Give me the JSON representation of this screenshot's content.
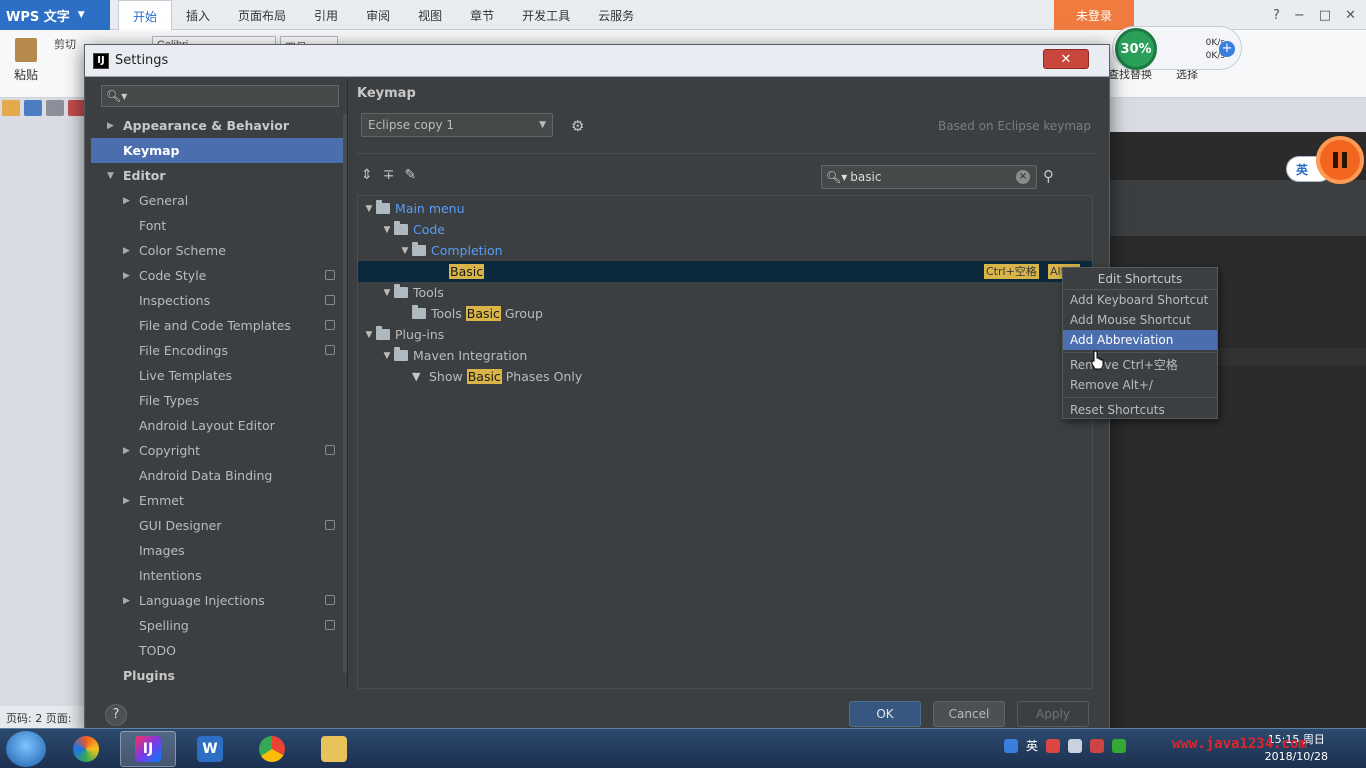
{
  "wps": {
    "app_name": "WPS 文字",
    "tabs": [
      "开始",
      "插入",
      "页面布局",
      "引用",
      "审阅",
      "视图",
      "章节",
      "开发工具",
      "云服务"
    ],
    "login": "未登录",
    "window_controls": [
      "?",
      "−",
      "□",
      "✕"
    ],
    "paste_label": "粘贴",
    "font_name": "Calibri",
    "font_size": "四号",
    "find_label": "查找替换",
    "select_label": "选择",
    "status_text": "页码: 2  页面:",
    "cut_label": "剪切"
  },
  "netmon": {
    "percent": "30%",
    "up": "0K/s",
    "down": "0K/s"
  },
  "recorder": {
    "lang": "英"
  },
  "dialog": {
    "title": "Settings",
    "close": "✕",
    "search_placeholder": "",
    "left_tree": [
      {
        "label": "Appearance & Behavior",
        "level": 0,
        "arrow": "▶",
        "bold": true
      },
      {
        "label": "Keymap",
        "level": 0,
        "arrow": "",
        "bold": true,
        "selected": true
      },
      {
        "label": "Editor",
        "level": 0,
        "arrow": "▼",
        "bold": true
      },
      {
        "label": "General",
        "level": 1,
        "arrow": "▶"
      },
      {
        "label": "Font",
        "level": 1,
        "arrow": ""
      },
      {
        "label": "Color Scheme",
        "level": 1,
        "arrow": "▶"
      },
      {
        "label": "Code Style",
        "level": 1,
        "arrow": "▶",
        "cfg": true
      },
      {
        "label": "Inspections",
        "level": 1,
        "arrow": "",
        "cfg": true
      },
      {
        "label": "File and Code Templates",
        "level": 1,
        "arrow": "",
        "cfg": true
      },
      {
        "label": "File Encodings",
        "level": 1,
        "arrow": "",
        "cfg": true
      },
      {
        "label": "Live Templates",
        "level": 1,
        "arrow": ""
      },
      {
        "label": "File Types",
        "level": 1,
        "arrow": ""
      },
      {
        "label": "Android Layout Editor",
        "level": 1,
        "arrow": ""
      },
      {
        "label": "Copyright",
        "level": 1,
        "arrow": "▶",
        "cfg": true
      },
      {
        "label": "Android Data Binding",
        "level": 1,
        "arrow": ""
      },
      {
        "label": "Emmet",
        "level": 1,
        "arrow": "▶"
      },
      {
        "label": "GUI Designer",
        "level": 1,
        "arrow": "",
        "cfg": true
      },
      {
        "label": "Images",
        "level": 1,
        "arrow": ""
      },
      {
        "label": "Intentions",
        "level": 1,
        "arrow": ""
      },
      {
        "label": "Language Injections",
        "level": 1,
        "arrow": "▶",
        "cfg": true
      },
      {
        "label": "Spelling",
        "level": 1,
        "arrow": "",
        "cfg": true
      },
      {
        "label": "TODO",
        "level": 1,
        "arrow": ""
      },
      {
        "label": "Plugins",
        "level": 0,
        "arrow": "",
        "bold": true
      }
    ],
    "keymap": {
      "title": "Keymap",
      "selected_keymap": "Eclipse copy 1",
      "based_on": "Based on Eclipse keymap",
      "filter_value": "basic",
      "tree": [
        {
          "label": "Main menu",
          "level": 0,
          "toggle": "▼",
          "icon": "folder",
          "color": "blue"
        },
        {
          "label": "Code",
          "level": 1,
          "toggle": "▼",
          "icon": "folder",
          "color": "blue"
        },
        {
          "label": "Completion",
          "level": 2,
          "toggle": "▼",
          "icon": "folder",
          "color": "blue"
        },
        {
          "pre": "",
          "hl": "Basic",
          "post": "",
          "level": 3,
          "toggle": "",
          "icon": "none",
          "selected": true,
          "shortcuts": [
            "Ctrl+空格",
            "Alt+/"
          ]
        },
        {
          "label": "Tools",
          "level": 1,
          "toggle": "▼",
          "icon": "folder"
        },
        {
          "pre": "Tools ",
          "hl": "Basic",
          "post": " Group",
          "level": 2,
          "toggle": "",
          "icon": "folder"
        },
        {
          "label": "Plug-ins",
          "level": 0,
          "toggle": "▼",
          "icon": "folder"
        },
        {
          "label": "Maven Integration",
          "level": 1,
          "toggle": "▼",
          "icon": "folder"
        },
        {
          "pre": "Show ",
          "hl": "Basic",
          "post": " Phases Only",
          "level": 2,
          "toggle": "",
          "icon": "funnel"
        }
      ]
    },
    "context_menu": {
      "title": "Edit Shortcuts",
      "items": [
        "Add Keyboard Shortcut",
        "Add Mouse Shortcut",
        "Add Abbreviation",
        "Remove Ctrl+空格",
        "Remove Alt+/",
        "Reset Shortcuts"
      ],
      "active_index": 2
    },
    "help": "?",
    "ok": "OK",
    "cancel": "Cancel",
    "apply": "Apply"
  },
  "taskbar": {
    "tray_lang": "英",
    "watermark": "www.java1234.com",
    "time": "15:15 周日",
    "date": "2018/10/28"
  },
  "colors": {
    "accent": "#4b6eaf",
    "highlight": "#d9b548",
    "link": "#589df6",
    "dialog_bg": "#3c3f41"
  }
}
